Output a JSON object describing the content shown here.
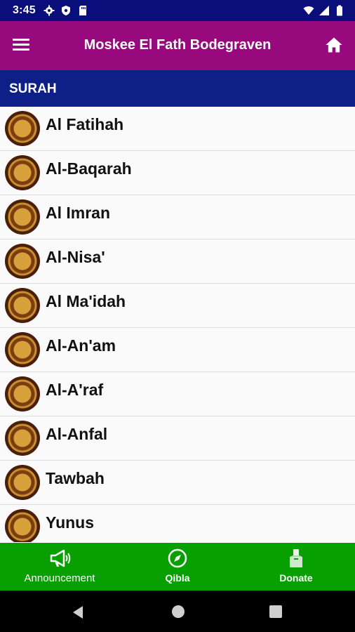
{
  "status_bar": {
    "time": "3:45"
  },
  "app_bar": {
    "title": "Moskee El Fath Bodegraven"
  },
  "section": {
    "title": "SURAH"
  },
  "surahs": [
    {
      "name": "Al Fatihah"
    },
    {
      "name": "Al-Baqarah"
    },
    {
      "name": "Al Imran"
    },
    {
      "name": "Al-Nisa'"
    },
    {
      "name": "Al Ma'idah"
    },
    {
      "name": "Al-An'am"
    },
    {
      "name": "Al-A'raf"
    },
    {
      "name": "Al-Anfal"
    },
    {
      "name": "Tawbah"
    },
    {
      "name": "Yunus"
    }
  ],
  "bottom_nav": {
    "items": [
      {
        "label": "Announcement",
        "icon": "megaphone-icon"
      },
      {
        "label": "Qibla",
        "icon": "compass-icon"
      },
      {
        "label": "Donate",
        "icon": "donation-box-icon"
      }
    ]
  },
  "colors": {
    "status_bar": "#0a0e7a",
    "app_bar": "#98097e",
    "section_header": "#0e2087",
    "bottom_nav": "#08a000"
  }
}
